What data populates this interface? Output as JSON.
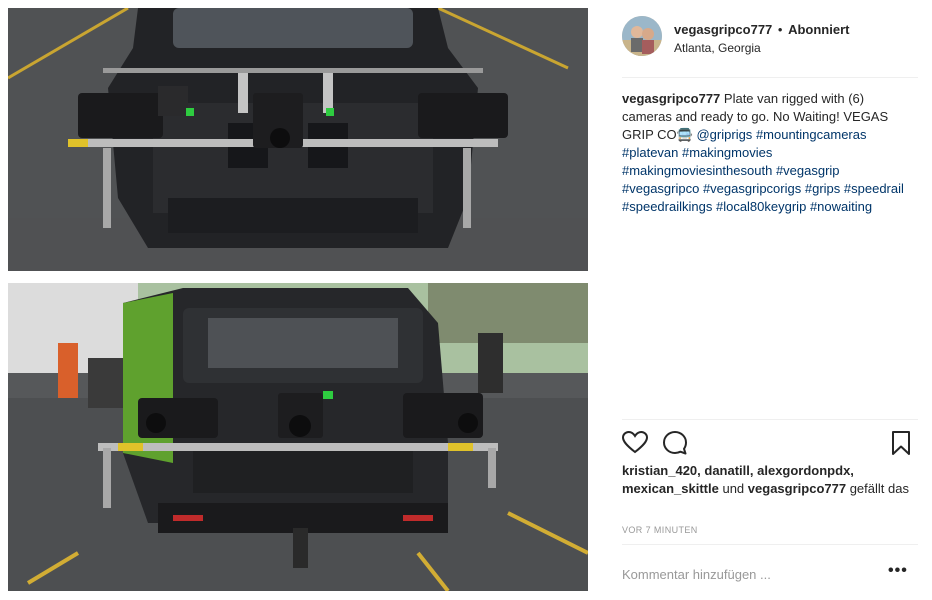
{
  "post": {
    "username": "vegasgripco777",
    "separator": "•",
    "follow_state": "Abonniert",
    "location": "Atlanta, Georgia",
    "avatar_icon": "profile-photo",
    "images": [
      {
        "name": "plate-van-front-rig-photo"
      },
      {
        "name": "plate-van-rear-rig-photo"
      }
    ]
  },
  "caption": {
    "username": "vegasgripco777",
    "text": "Plate van rigged with (6) cameras and ready to go. No Waiting! VEGAS GRIP CO",
    "emoji": "🚍",
    "mention": "@griprigs",
    "hashtags": [
      "#mountingcameras",
      "#platevan",
      "#makingmovies",
      "#makingmoviesinthesouth",
      "#vegasgrip",
      "#vegasgripco",
      "#vegasgripcorigs",
      "#grips",
      "#speedrail",
      "#speedrailkings",
      "#local80keygrip",
      "#nowaiting"
    ]
  },
  "actions": {
    "like_icon": "heart-outline",
    "comment_icon": "speech-bubble",
    "save_icon": "bookmark-outline"
  },
  "likes": {
    "users_line1": "kristian_420, danatill, alexgordonpdx,",
    "user_a": "mexican_skittle",
    "connector": "und",
    "user_b": "vegasgripco777",
    "suffix": "gefällt das"
  },
  "timestamp": "VOR 7 MINUTEN",
  "comment": {
    "placeholder": "Kommentar hinzufügen ...",
    "more_label": "•••"
  },
  "colors": {
    "text": "#262626",
    "link": "#003569",
    "muted": "#999999",
    "divider": "#efefef"
  }
}
